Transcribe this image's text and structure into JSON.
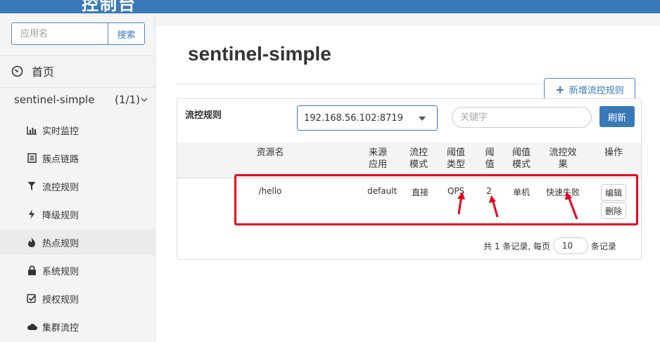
{
  "header": {
    "brand": "控制台"
  },
  "sidebar": {
    "search_placeholder": "应用名",
    "search_button": "搜索",
    "home_label": "首页",
    "app_name": "sentinel-simple",
    "app_count": "(1/1)",
    "menu": [
      {
        "label": "实时监控",
        "icon": "bar-chart-icon"
      },
      {
        "label": "簇点链路",
        "icon": "list-icon"
      },
      {
        "label": "流控规则",
        "icon": "filter-icon"
      },
      {
        "label": "降级规则",
        "icon": "flash-icon"
      },
      {
        "label": "热点规则",
        "icon": "fire-icon"
      },
      {
        "label": "系统规则",
        "icon": "lock-icon"
      },
      {
        "label": "授权规则",
        "icon": "check-square-icon"
      },
      {
        "label": "集群流控",
        "icon": "cloud-icon"
      }
    ]
  },
  "main": {
    "title": "sentinel-simple",
    "add_rule_button": "新增流控规则",
    "panel": {
      "title": "流控规则",
      "machine_select": "192.168.56.102:8719",
      "keyword_placeholder": "关键字",
      "refresh_button": "刷新",
      "columns": {
        "resource": "资源名",
        "source_1": "来源",
        "source_2": "应用",
        "mode_1": "流控",
        "mode_2": "模式",
        "grade_1": "阈值",
        "grade_2": "类型",
        "count_1": "阈",
        "count_2": "值",
        "cluster_1": "阈值",
        "cluster_2": "模式",
        "effect_1": "流控效",
        "effect_2": "果",
        "ops": "操作"
      },
      "rows": [
        {
          "resource": "/hello",
          "source": "default",
          "mode": "直接",
          "grade": "QPS",
          "count": "2",
          "cluster": "单机",
          "effect": "快速失败",
          "edit": "编辑",
          "delete": "删除"
        }
      ],
      "pager": {
        "prefix": "共 1 条记录, 每页",
        "page_size": "10",
        "suffix": "条记录"
      }
    }
  },
  "colors": {
    "brand_blue": "#3a79b8",
    "annotation_red": "#e8001c"
  }
}
